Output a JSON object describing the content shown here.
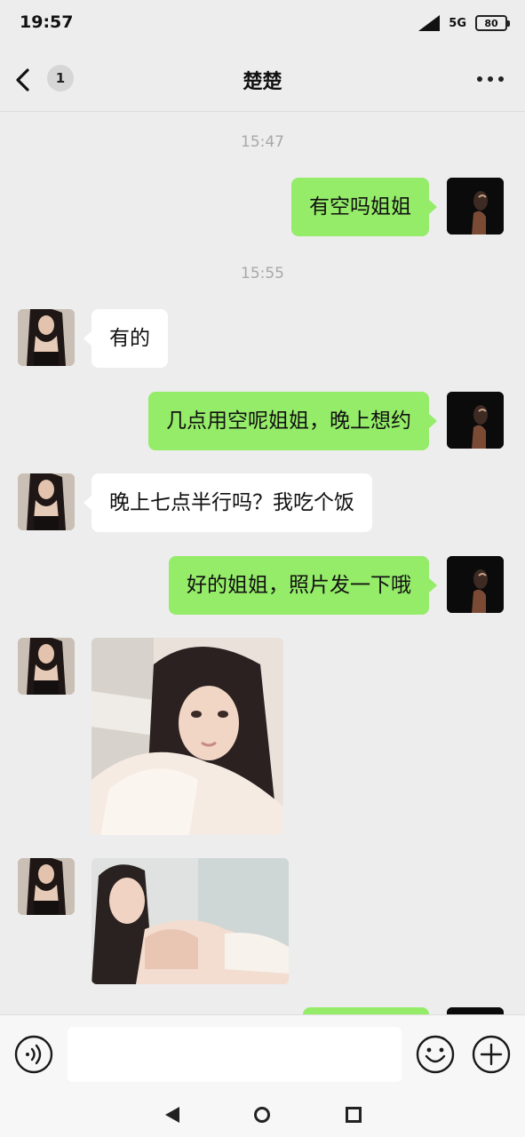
{
  "status_bar": {
    "time": "19:57",
    "network": "5G",
    "battery": "80"
  },
  "header": {
    "unread_count": "1",
    "title": "楚楚"
  },
  "conversation": {
    "timestamps": [
      "15:47",
      "15:55"
    ],
    "messages": [
      {
        "sender": "me",
        "type": "text",
        "text": "有空吗姐姐"
      },
      {
        "sender": "them",
        "type": "text",
        "text": "有的"
      },
      {
        "sender": "me",
        "type": "text",
        "text": "几点用空呢姐姐，晚上想约"
      },
      {
        "sender": "them",
        "type": "text",
        "text": "晚上七点半行吗？我吃个饭"
      },
      {
        "sender": "me",
        "type": "text",
        "text": "好的姐姐，照片发一下哦"
      },
      {
        "sender": "them",
        "type": "image"
      },
      {
        "sender": "them",
        "type": "image"
      },
      {
        "sender": "me",
        "type": "text",
        "text": ""
      }
    ]
  },
  "input_bar": {
    "message_value": ""
  },
  "icons": {
    "back": "chevron-left-icon",
    "more": "more-dots-icon",
    "voice": "voice-icon",
    "emoji": "emoji-icon",
    "plus": "plus-icon"
  },
  "colors": {
    "sent_bubble": "#95ec69",
    "received_bubble": "#ffffff",
    "background": "#ededed"
  }
}
